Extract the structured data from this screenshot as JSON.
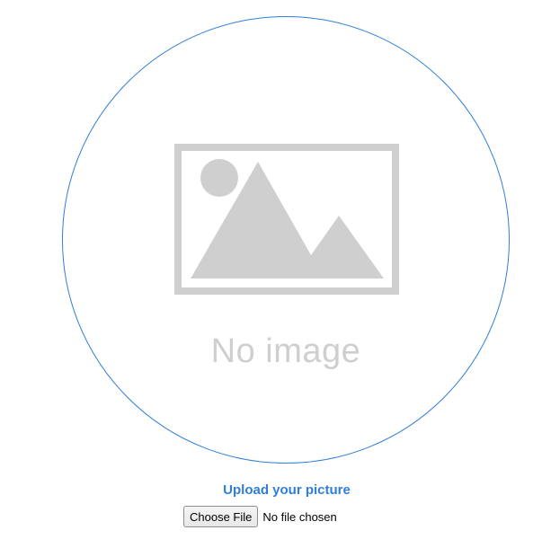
{
  "avatar": {
    "placeholder_text": "No image",
    "placeholder_icon": "image-placeholder-icon",
    "border_color": "#2f7fd6",
    "placeholder_color": "#cfcfcf"
  },
  "upload": {
    "label": "Upload your picture",
    "label_color": "#2f7fd6",
    "button_label": "Choose File",
    "file_status": "No file chosen"
  }
}
